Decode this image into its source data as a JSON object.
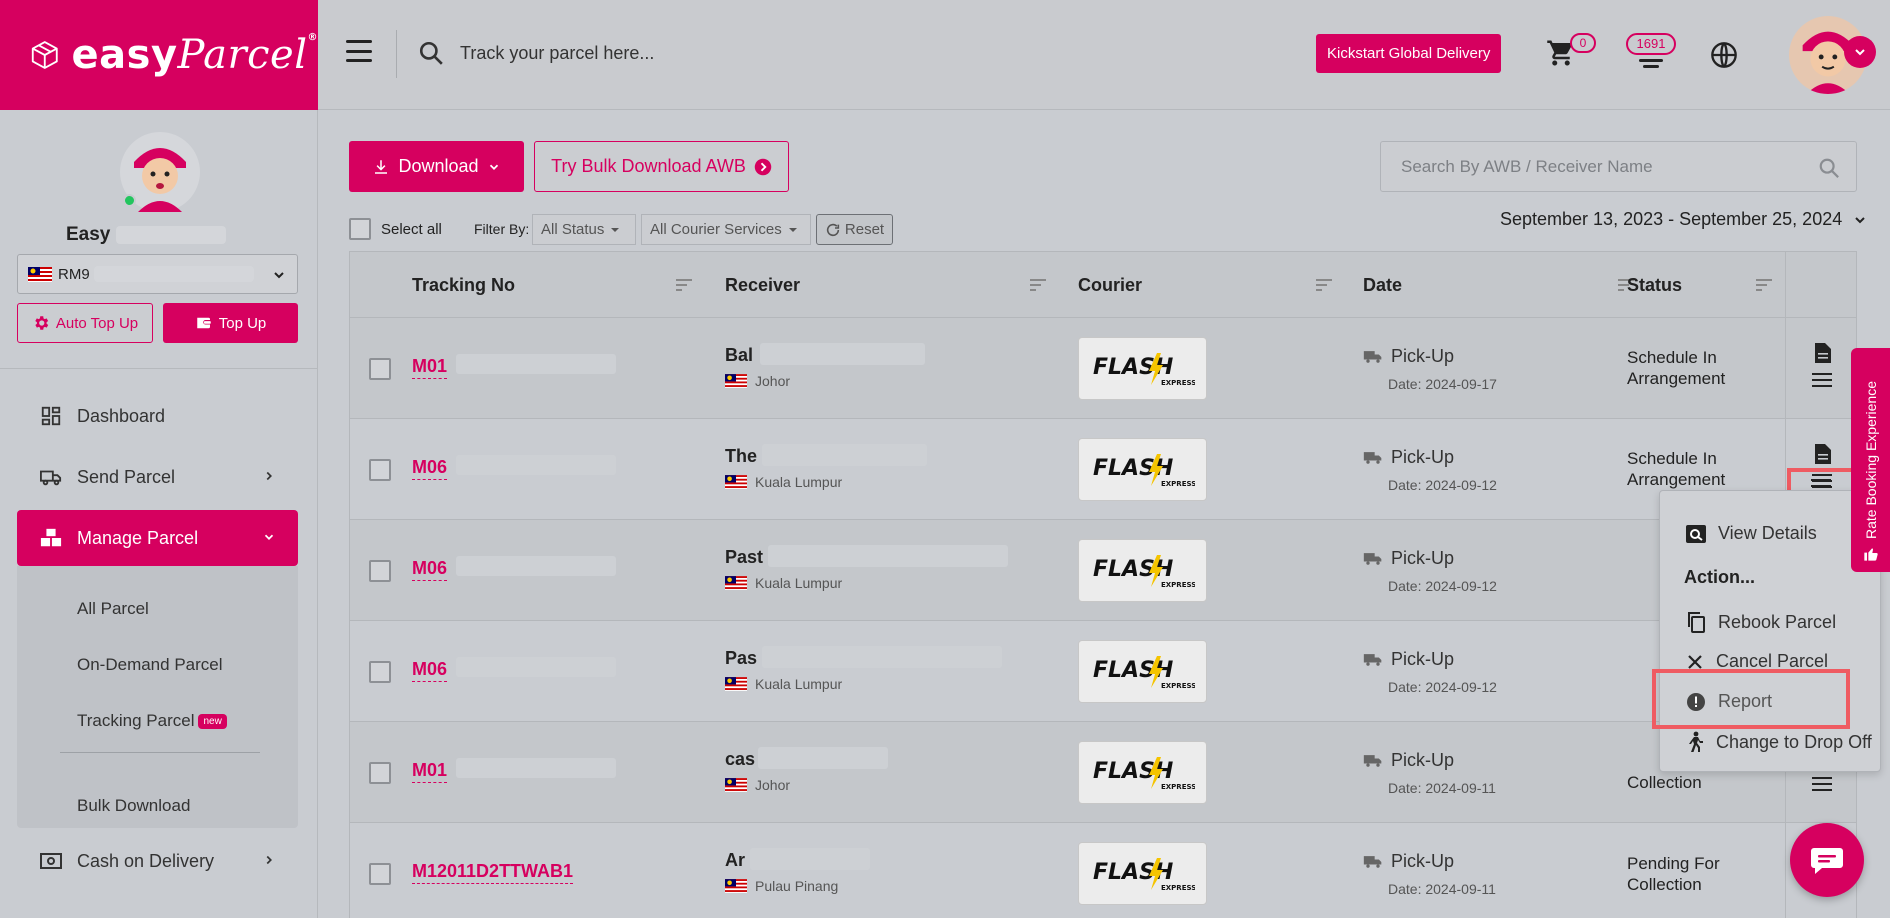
{
  "header": {
    "logo_text": "easy",
    "logo_text_script": "Parcel",
    "logo_reg": "®",
    "track_placeholder": "Track your parcel here...",
    "kickstart_label": "Kickstart Global Delivery",
    "cart_count": "0",
    "credit_count": "1691"
  },
  "sidebar": {
    "user_name": "Easy",
    "wallet_balance": "RM9",
    "auto_topup_label": "Auto Top Up",
    "topup_label": "Top Up",
    "nav": [
      {
        "label": "Dashboard"
      },
      {
        "label": "Send Parcel"
      },
      {
        "label": "Manage Parcel"
      },
      {
        "label": "Cash on Delivery"
      }
    ],
    "subnav": [
      {
        "label": "All Parcel"
      },
      {
        "label": "On-Demand Parcel"
      },
      {
        "label": "Tracking Parcel",
        "badge": "new"
      },
      {
        "label": "Bulk Download"
      }
    ]
  },
  "toolbar": {
    "download_label": "Download",
    "bulk_label": "Try Bulk Download AWB",
    "search_placeholder": "Search By AWB / Receiver Name",
    "select_all_label": "Select all",
    "filter_label": "Filter By:",
    "status_filter": "All Status",
    "courier_filter": "All Courier Services",
    "reset_label": "Reset",
    "date_range": "September 13, 2023 - September 25, 2024"
  },
  "table": {
    "headers": {
      "tracking": "Tracking No",
      "receiver": "Receiver",
      "courier": "Courier",
      "date": "Date",
      "status": "Status"
    },
    "rows": [
      {
        "tracking": "M01",
        "receiver": "Bal",
        "location": "Johor",
        "courier": "FLASH",
        "date_type": "Pick-Up",
        "date": "Date: 2024-09-17",
        "status": "Schedule In Arrangement"
      },
      {
        "tracking": "M06",
        "receiver": "The",
        "location": "Kuala Lumpur",
        "courier": "FLASH",
        "date_type": "Pick-Up",
        "date": "Date: 2024-09-12",
        "status": "Schedule In Arrangement"
      },
      {
        "tracking": "M06",
        "receiver": "Past",
        "location": "Kuala Lumpur",
        "courier": "FLASH",
        "date_type": "Pick-Up",
        "date": "Date: 2024-09-12",
        "status": ""
      },
      {
        "tracking": "M06",
        "receiver": "Pas",
        "location": "Kuala Lumpur",
        "courier": "FLASH",
        "date_type": "Pick-Up",
        "date": "Date: 2024-09-12",
        "status": ""
      },
      {
        "tracking": "M01",
        "receiver": "cas",
        "location": "Johor",
        "courier": "FLASH",
        "date_type": "Pick-Up",
        "date": "Date: 2024-09-11",
        "status": "Collection"
      },
      {
        "tracking": "M12011D2TTWAB1",
        "receiver": "Ar",
        "location": "Pulau Pinang",
        "courier": "FLASH",
        "date_type": "Pick-Up",
        "date": "Date: 2024-09-11",
        "status": "Pending For Collection"
      }
    ]
  },
  "dropdown": {
    "view_details": "View Details",
    "action_title": "Action...",
    "rebook": "Rebook Parcel",
    "cancel": "Cancel Parcel",
    "report": "Report",
    "drop_off": "Change to Drop Off"
  },
  "side_tab": {
    "label": "Rate Booking Experience"
  },
  "courier_logo": {
    "main": "FLASH",
    "sub": "EXPRESS"
  },
  "colors": {
    "brand": "#d6005f",
    "highlight": "#ef5b62"
  }
}
